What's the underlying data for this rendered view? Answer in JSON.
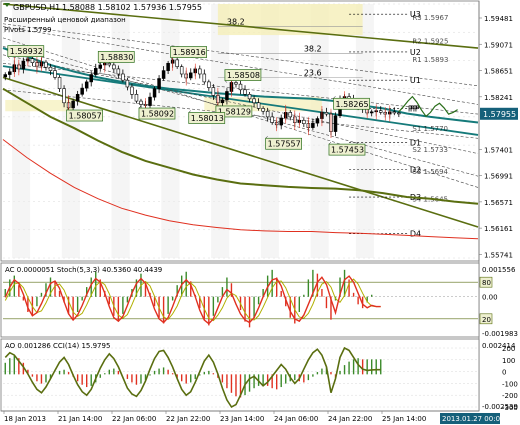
{
  "header": {
    "title": "GBPUSD,H1",
    "ohlc": "1.58088 1.58102 1.57936 1.57955",
    "range_label": "Расширенный ценовой диапазон",
    "range_sub": "Pivots 1.5799"
  },
  "colors": {
    "bull": "#000000",
    "bear": "#ffffff",
    "ma_teal": "#157a7a",
    "ma_olive": "#5a6e10",
    "ma_red": "#e03020",
    "fib_band": "#f5efb8",
    "grid": "#d8d8d8",
    "price_tag": "#15607a"
  },
  "chart_data": [
    {
      "type": "candlestick",
      "name": "GBPUSD,H1",
      "ylim": [
        1.554,
        1.599
      ],
      "y_ticks": [
        "1.59481",
        "1.59071",
        "1.58651",
        "1.58241",
        "1.57955",
        "1.57401",
        "1.56991",
        "1.56571",
        "1.56161",
        "1.55741"
      ],
      "x_ticks": [
        "18 Jan 2013",
        "21 Jan 14:00",
        "22 Jan 06:00",
        "22 Jan 22:00",
        "23 Jan 14:00",
        "24 Jan 06:00",
        "24 Jan 22:00",
        "25 Jan 14:00"
      ],
      "last_price": "1.57955",
      "last_time": "2013.01.27 00:00",
      "close": [
        1.5865,
        1.587,
        1.5882,
        1.5875,
        1.5889,
        1.5893,
        1.5886,
        1.588,
        1.5887,
        1.5878,
        1.5872,
        1.586,
        1.584,
        1.5815,
        1.5806,
        1.5818,
        1.583,
        1.5841,
        1.5852,
        1.5865,
        1.5876,
        1.5882,
        1.5885,
        1.5882,
        1.5875,
        1.5866,
        1.5855,
        1.5843,
        1.583,
        1.5818,
        1.5812,
        1.581,
        1.5825,
        1.584,
        1.5858,
        1.5872,
        1.5885,
        1.5891,
        1.5879,
        1.5866,
        1.5859,
        1.5868,
        1.5875,
        1.5866,
        1.5852,
        1.5842,
        1.5828,
        1.5815,
        1.582,
        1.5835,
        1.5851,
        1.5848,
        1.5838,
        1.583,
        1.5822,
        1.5815,
        1.5805,
        1.58,
        1.579,
        1.578,
        1.5776,
        1.5788,
        1.5798,
        1.579,
        1.578,
        1.5784,
        1.5778,
        1.5771,
        1.5779,
        1.5787,
        1.5798,
        1.5795,
        1.5764,
        1.5792,
        1.582,
        1.5826,
        1.5821,
        1.5814,
        1.5808,
        1.5805,
        1.5797,
        1.5799,
        1.5801,
        1.5798,
        1.5795,
        1.5799,
        1.5797,
        1.5796
      ],
      "projection": [
        1.5799,
        1.5808,
        1.5818,
        1.5826,
        1.5816,
        1.5802,
        1.5791,
        1.5798,
        1.5809,
        1.5814,
        1.5806,
        1.5795,
        1.5798,
        1.5803
      ],
      "price_labels": [
        {
          "text": "1.58932",
          "value": 1.58932,
          "at": 1
        },
        {
          "text": "1.58830",
          "value": 1.5883,
          "at": 21
        },
        {
          "text": "1.58916",
          "value": 1.58916,
          "at": 37
        },
        {
          "text": "1.58508",
          "value": 1.58508,
          "at": 49
        },
        {
          "text": "1.58265",
          "value": 1.58265,
          "at": 73
        },
        {
          "text": "1.58057",
          "value": 1.58057,
          "at": 14
        },
        {
          "text": "1.58092",
          "value": 1.58092,
          "at": 30
        },
        {
          "text": "1.58129",
          "value": 1.58129,
          "at": 47
        },
        {
          "text": "1.58013",
          "value": 1.58013,
          "at": 41
        },
        {
          "text": "1.57557",
          "value": 1.57557,
          "at": 58
        },
        {
          "text": "1.57453",
          "value": 1.57453,
          "at": 72
        }
      ],
      "levels": [
        {
          "name": "U3",
          "value": 1.5972
        },
        {
          "name": "U2",
          "value": 1.5905
        },
        {
          "name": "U1",
          "value": 1.5855
        },
        {
          "name": "PP",
          "value": 1.5805
        },
        {
          "name": "D1",
          "value": 1.5745
        },
        {
          "name": "D2",
          "value": 1.5697
        },
        {
          "name": "D3",
          "value": 1.5648
        },
        {
          "name": "D4",
          "value": 1.5583
        }
      ],
      "fib_labels": [
        {
          "text": "38.2",
          "value": 1.595
        },
        {
          "text": "38.2",
          "value": 1.5902
        },
        {
          "text": "23.6",
          "value": 1.586
        }
      ],
      "faint_labels": [
        "R3 1.5967",
        "R2 1.5925",
        "R1 1.5893",
        "S1 1.5770",
        "S2 1.5733",
        "S3 1.5694",
        "S4 1.5645"
      ],
      "pp_label": "PP",
      "ma_teal": [
        1.5912,
        1.5897,
        1.5882,
        1.587,
        1.586,
        1.5852,
        1.5845,
        1.584,
        1.5836,
        1.5832,
        1.5829,
        1.5826,
        1.5824,
        1.5822,
        1.5818,
        1.5811,
        1.5805,
        1.5796,
        1.579,
        1.5785,
        1.578
      ],
      "ma_olive": [
        1.584,
        1.5815,
        1.579,
        1.577,
        1.5748,
        1.5728,
        1.5712,
        1.57,
        1.5688,
        1.5679,
        1.5672,
        1.5669,
        1.5666,
        1.5664,
        1.5663,
        1.566,
        1.5655,
        1.5648,
        1.5645,
        1.564,
        1.5636
      ],
      "ma_red": [
        1.575,
        1.5718,
        1.569,
        1.5665,
        1.5645,
        1.5628,
        1.5616,
        1.5606,
        1.5599,
        1.5594,
        1.559,
        1.5588,
        1.5587,
        1.5587,
        1.5585,
        1.5584,
        1.5582,
        1.558,
        1.5578,
        1.5576,
        1.5574
      ],
      "channel_lines": [
        {
          "from": 1.599,
          "to": 1.5912,
          "style": "solid-olive"
        },
        {
          "from": 1.588,
          "to": 1.5758,
          "style": "solid-teal"
        },
        {
          "from": 1.586,
          "to": 1.5595,
          "style": "solid-olive"
        },
        {
          "from": 1.595,
          "to": 1.5812,
          "style": "dash"
        },
        {
          "from": 1.593,
          "to": 1.5665,
          "style": "dash"
        },
        {
          "from": 1.59,
          "to": 1.5725,
          "style": "dash"
        },
        {
          "from": 1.5838,
          "to": 1.5752,
          "style": "dash"
        },
        {
          "from": 1.5885,
          "to": 1.5795,
          "style": "dash"
        },
        {
          "from": 1.5915,
          "to": 1.5685,
          "style": "dash"
        },
        {
          "from": 1.5955,
          "to": 1.5845,
          "style": "dash"
        }
      ]
    },
    {
      "type": "bar",
      "name": "AC / Stochastic",
      "header": "AC 0.0000051  Stoch(5,3,3) 40.5360 40.4439",
      "y_ticks": [
        "0.001556",
        "0.00",
        "-0.001983"
      ],
      "levels_text": [
        "80",
        "20"
      ],
      "ylim": [
        -0.002,
        0.0016
      ],
      "ac": [
        0.0004,
        0.0009,
        0.0011,
        0.0006,
        -0.0002,
        -0.0008,
        -0.001,
        -0.0005,
        0.0002,
        0.0007,
        0.001,
        0.0008,
        0.0003,
        -0.0003,
        -0.0009,
        -0.0012,
        -0.0008,
        -0.0002,
        0.0005,
        0.001,
        0.0013,
        0.0009,
        0.0003,
        -0.0004,
        -0.001,
        -0.0013,
        -0.0009,
        -0.0003,
        0.0004,
        0.0009,
        0.0012,
        0.0008,
        0.0002,
        -0.0005,
        -0.0011,
        -0.0014,
        -0.0009,
        -0.0002,
        0.0006,
        0.0011,
        0.0013,
        0.0008,
        0.0001,
        -0.0006,
        -0.0012,
        -0.0015,
        -0.001,
        -0.0003,
        0.0005,
        0.001,
        0.0007,
        0.0,
        -0.0007,
        -0.0013,
        -0.0016,
        -0.0011,
        -0.0004,
        0.0004,
        0.0011,
        0.0014,
        0.001,
        0.0003,
        -0.0005,
        -0.0011,
        -0.0014,
        -0.0008,
        0.0001,
        0.0009,
        0.0014,
        0.0012,
        0.0004,
        -0.0006,
        -0.0012,
        -0.0002,
        0.001,
        0.0014,
        0.0009,
        0.0002,
        -0.0004,
        -0.0006,
        -0.0003,
        0.0001,
        0.0,
        0.0
      ],
      "stoch_k": [
        55,
        72,
        84,
        78,
        60,
        38,
        25,
        30,
        45,
        62,
        78,
        82,
        70,
        48,
        28,
        18,
        26,
        42,
        60,
        76,
        86,
        80,
        62,
        40,
        22,
        16,
        24,
        42,
        62,
        78,
        86,
        78,
        58,
        36,
        20,
        14,
        22,
        40,
        60,
        76,
        84,
        76,
        56,
        34,
        18,
        12,
        20,
        38,
        56,
        68,
        62,
        44,
        28,
        18,
        14,
        22,
        38,
        56,
        72,
        84,
        86,
        74,
        52,
        32,
        20,
        16,
        26,
        44,
        62,
        80,
        88,
        76,
        52,
        30,
        60,
        84,
        90,
        80,
        62,
        44,
        38,
        42,
        40,
        40
      ],
      "stoch_d": [
        50,
        64,
        77,
        79,
        71,
        55,
        40,
        30,
        33,
        46,
        62,
        74,
        77,
        67,
        49,
        31,
        24,
        29,
        43,
        59,
        74,
        81,
        76,
        61,
        41,
        26,
        21,
        27,
        43,
        61,
        75,
        81,
        74,
        57,
        38,
        23,
        19,
        28,
        41,
        59,
        73,
        79,
        72,
        55,
        36,
        21,
        17,
        26,
        38,
        54,
        62,
        58,
        45,
        30,
        20,
        18,
        25,
        39,
        55,
        71,
        81,
        82,
        71,
        53,
        35,
        23,
        21,
        29,
        44,
        63,
        77,
        81,
        72,
        53,
        47,
        58,
        78,
        85,
        77,
        62,
        48,
        41,
        40,
        40
      ]
    },
    {
      "type": "bar",
      "name": "AO / CCI",
      "header": "AO 0.001286  CCI(14) 15.9795",
      "y_ticks": [
        "0.002414",
        "-0.002539"
      ],
      "level_ticks": [
        "200",
        "100",
        "0",
        "-100",
        "-200",
        "-300"
      ],
      "ylim": [
        -0.003,
        0.0028
      ],
      "ao": [
        0.001,
        0.0014,
        0.0016,
        0.0014,
        0.001,
        0.0004,
        -0.0002,
        -0.0006,
        -0.0008,
        -0.0007,
        -0.0004,
        0.0,
        0.0003,
        0.0004,
        0.0002,
        -0.0002,
        -0.0006,
        -0.0009,
        -0.0011,
        -0.001,
        -0.0007,
        -0.0003,
        0.0001,
        0.0004,
        0.0005,
        0.0003,
        0.0,
        -0.0004,
        -0.0007,
        -0.0009,
        -0.0008,
        -0.0005,
        -0.0001,
        0.0003,
        0.0005,
        0.0006,
        0.0004,
        0.0001,
        -0.0003,
        -0.0006,
        -0.0008,
        -0.0007,
        -0.0004,
        -0.0001,
        0.0002,
        0.0003,
        0.0001,
        -0.0003,
        -0.0007,
        -0.0012,
        -0.0016,
        -0.0019,
        -0.002,
        -0.0018,
        -0.0015,
        -0.0012,
        -0.001,
        -0.0009,
        -0.001,
        -0.0012,
        -0.0013,
        -0.0011,
        -0.0008,
        -0.0006,
        -0.0005,
        -0.0006,
        -0.0007,
        -0.0005,
        -0.0002,
        0.0002,
        0.0005,
        0.0006,
        0.0002,
        -0.0003,
        0.0003,
        0.0008,
        0.0011,
        0.0013,
        0.0014,
        0.0013,
        0.0013,
        0.0013,
        0.0013,
        0.0013
      ],
      "cci": [
        120,
        160,
        140,
        90,
        40,
        -20,
        -90,
        -150,
        -180,
        -130,
        -60,
        10,
        80,
        120,
        60,
        -30,
        -110,
        -170,
        -200,
        -150,
        -60,
        30,
        100,
        150,
        110,
        40,
        -50,
        -140,
        -190,
        -210,
        -160,
        -80,
        20,
        110,
        170,
        180,
        120,
        40,
        -60,
        -150,
        -200,
        -170,
        -90,
        0,
        90,
        140,
        80,
        -20,
        -140,
        -240,
        -300,
        -280,
        -200,
        -110,
        -60,
        -40,
        -80,
        -120,
        -90,
        -40,
        10,
        60,
        20,
        -50,
        -100,
        -60,
        20,
        100,
        160,
        190,
        140,
        40,
        -180,
        -60,
        120,
        200,
        180,
        120,
        60,
        20,
        10,
        14,
        16,
        16
      ]
    }
  ]
}
